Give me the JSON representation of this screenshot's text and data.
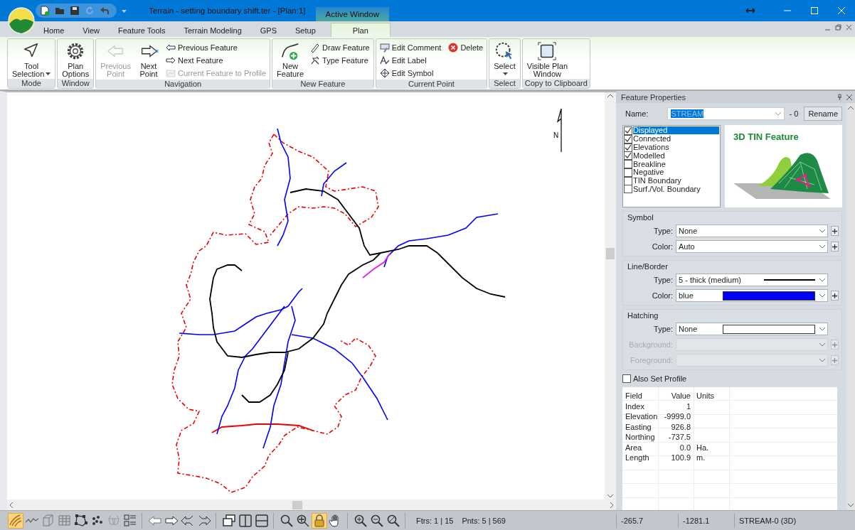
{
  "window": {
    "title": "Terrain - setting boundary shift.ter - [Plan:1]",
    "context_tab": "Active Window"
  },
  "tabs": [
    {
      "label": "Home",
      "selected": false
    },
    {
      "label": "View",
      "selected": false
    },
    {
      "label": "Feature Tools",
      "selected": false
    },
    {
      "label": "Terrain Modeling",
      "selected": false
    },
    {
      "label": "GPS",
      "selected": false
    },
    {
      "label": "Setup",
      "selected": false
    },
    {
      "label": "Plan",
      "selected": true
    }
  ],
  "ribbon": [
    {
      "label": "Mode",
      "items": [
        {
          "kind": "large",
          "label": "Tool\nSelection",
          "dropdown": true,
          "disabled": false
        }
      ]
    },
    {
      "label": "Window",
      "items": [
        {
          "kind": "large",
          "label": "Plan\nOptions",
          "dropdown": false,
          "disabled": false
        }
      ]
    },
    {
      "label": "Navigation",
      "items": [
        {
          "kind": "large",
          "label": "Previous\nPoint",
          "dropdown": false,
          "disabled": true
        },
        {
          "kind": "large",
          "label": "Next\nPoint",
          "dropdown": false,
          "disabled": false
        },
        {
          "kind": "small",
          "label": "Previous Feature",
          "dropdown": false,
          "disabled": false
        },
        {
          "kind": "small",
          "label": "Next Feature",
          "dropdown": false,
          "disabled": false
        },
        {
          "kind": "small",
          "label": "Current Feature to Profile",
          "dropdown": false,
          "disabled": true
        }
      ]
    },
    {
      "label": "New Feature",
      "items": [
        {
          "kind": "large",
          "label": "New\nFeature",
          "dropdown": false,
          "disabled": false
        },
        {
          "kind": "small",
          "label": "Draw Feature",
          "dropdown": false,
          "disabled": false
        },
        {
          "kind": "small",
          "label": "Type Feature",
          "dropdown": false,
          "disabled": false
        }
      ]
    },
    {
      "label": "Current Point",
      "items": [
        {
          "kind": "small",
          "label": "Edit Comment",
          "dropdown": false,
          "disabled": false
        },
        {
          "kind": "small",
          "label": "Edit Label",
          "dropdown": false,
          "disabled": false
        },
        {
          "kind": "small",
          "label": "Edit Symbol",
          "dropdown": false,
          "disabled": false
        },
        {
          "kind": "small",
          "label": "Delete",
          "dropdown": false,
          "disabled": false
        }
      ]
    },
    {
      "label": "Select",
      "items": [
        {
          "kind": "large",
          "label": "Select",
          "dropdown": true,
          "disabled": false
        }
      ]
    },
    {
      "label": "Copy to Clipboard",
      "items": [
        {
          "kind": "large",
          "label": "Visible Plan\nWindow",
          "dropdown": false,
          "disabled": false
        }
      ]
    }
  ],
  "plan": {
    "north_label": "N"
  },
  "panel": {
    "title": "Feature Properties",
    "name_label": "Name:",
    "name_value": "STREAM",
    "name_suffix": "- 0",
    "rename": "Rename",
    "flags": [
      {
        "label": "Displayed",
        "checked": true,
        "selected": true
      },
      {
        "label": "Connected",
        "checked": true,
        "selected": false
      },
      {
        "label": "Elevations",
        "checked": true,
        "selected": false
      },
      {
        "label": "Modelled",
        "checked": true,
        "selected": false
      },
      {
        "label": "Breakline",
        "checked": false,
        "selected": false
      },
      {
        "label": "Negative",
        "checked": false,
        "selected": false
      },
      {
        "label": "TIN Boundary",
        "checked": false,
        "selected": false
      },
      {
        "label": "Surf./Vol. Boundary",
        "checked": false,
        "selected": false
      }
    ],
    "preview_title": "3D TIN Feature",
    "sections": [
      {
        "title": "Symbol",
        "rows": [
          {
            "label": "Type:",
            "value": "None",
            "kind": "text",
            "disabled": false,
            "plus": true
          },
          {
            "label": "Color:",
            "value": "Auto",
            "kind": "text",
            "disabled": false,
            "plus": true
          }
        ]
      },
      {
        "title": "Line/Border",
        "rows": [
          {
            "label": "Type:",
            "value": "5 - thick (medium)",
            "kind": "line",
            "disabled": false,
            "plus": false
          },
          {
            "label": "Color:",
            "value": "blue",
            "kind": "fill",
            "color": "#0000ff",
            "disabled": false,
            "plus": true
          }
        ]
      },
      {
        "title": "Hatching",
        "rows": [
          {
            "label": "Type:",
            "value": "None",
            "kind": "fill",
            "color": "#ffffff",
            "disabled": false,
            "plus": false
          },
          {
            "label": "Background:",
            "kind": "text",
            "disabled": true,
            "plus": true
          },
          {
            "label": "Foreground:",
            "kind": "text",
            "disabled": true,
            "plus": true
          }
        ]
      }
    ],
    "also_set_profile": {
      "label": "Also Set Profile",
      "checked": false
    },
    "table": {
      "columns": [
        "Field",
        "Value",
        "Units"
      ],
      "rows": [
        {
          "field": "Index",
          "value": "1"
        },
        {
          "field": "Elevation",
          "value": "-9999.0"
        },
        {
          "field": "Easting",
          "value": "926.8"
        },
        {
          "field": "Northing",
          "value": "-737.5"
        },
        {
          "field": "Area",
          "value": "0.0",
          "units": "Ha."
        },
        {
          "field": "Length",
          "value": "100.9",
          "units": "m."
        }
      ]
    }
  },
  "map_tools": [
    [
      {
        "on": true
      },
      {
        "on": false
      },
      {
        "on": false
      },
      {
        "on": false
      },
      {
        "on": false
      },
      {
        "on": false
      },
      {
        "on": false
      },
      {
        "on": false
      }
    ],
    [
      {
        "on": false
      },
      {
        "on": false
      },
      {
        "on": false
      },
      {
        "on": false
      }
    ],
    [
      {
        "on": false
      },
      {
        "on": false
      },
      {
        "on": false
      }
    ],
    [
      {
        "on": false
      },
      {
        "on": false
      },
      {
        "on": true
      },
      {
        "on": false
      }
    ],
    [
      {
        "on": false
      },
      {
        "on": false
      },
      {
        "on": false
      }
    ]
  ],
  "status": {
    "features": "Ftrs: 1 | 15",
    "points": "Pnts: 5 | 569",
    "cells": [
      "-265.7",
      "-1281.1",
      "STREAM-0 (3D)"
    ]
  }
}
